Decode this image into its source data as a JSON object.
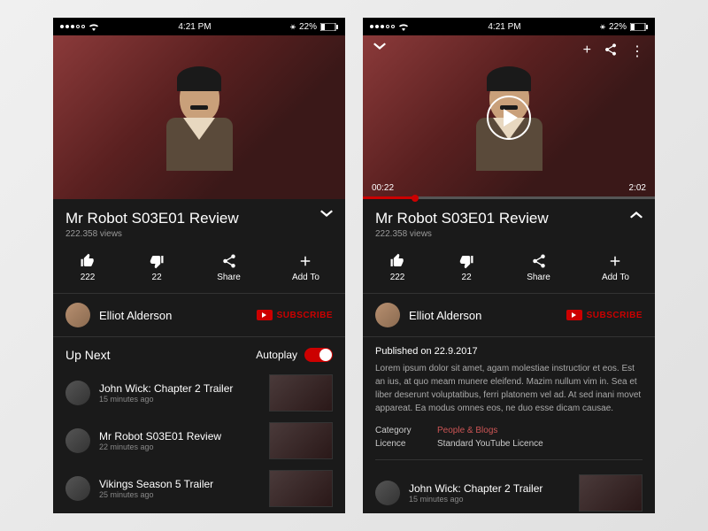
{
  "status": {
    "time": "4:21 PM",
    "battery": "22%"
  },
  "video": {
    "elapsed": "00:22",
    "duration": "2:02"
  },
  "title": "Mr Robot S03E01 Review",
  "views": "222.358 views",
  "actions": {
    "likes": "222",
    "dislikes": "22",
    "share": "Share",
    "addto": "Add To"
  },
  "channel": {
    "name": "Elliot Alderson",
    "subscribe": "SUBSCRIBE"
  },
  "upnext": {
    "label": "Up Next",
    "autoplay": "Autoplay"
  },
  "items": [
    {
      "title": "John Wick: Chapter 2 Trailer",
      "meta": "15 minutes ago"
    },
    {
      "title": "Mr Robot S03E01 Review",
      "meta": "22 minutes ago"
    },
    {
      "title": "Vikings Season 5 Trailer",
      "meta": "25 minutes ago"
    }
  ],
  "details": {
    "published": "Published on 22.9.2017",
    "desc": "Lorem ipsum dolor sit amet, agam molestiae instructior et eos. Est an ius, at quo meam munere eleifend. Mazim nullum vim in. Sea et liber deserunt voluptatibus, ferri platonem vel ad. At sed inani movet appareat. Ea modus omnes eos, ne duo esse dicam causae.",
    "category_label": "Category",
    "category": "People & Blogs",
    "licence_label": "Licence",
    "licence": "Standard YouTube Licence"
  }
}
